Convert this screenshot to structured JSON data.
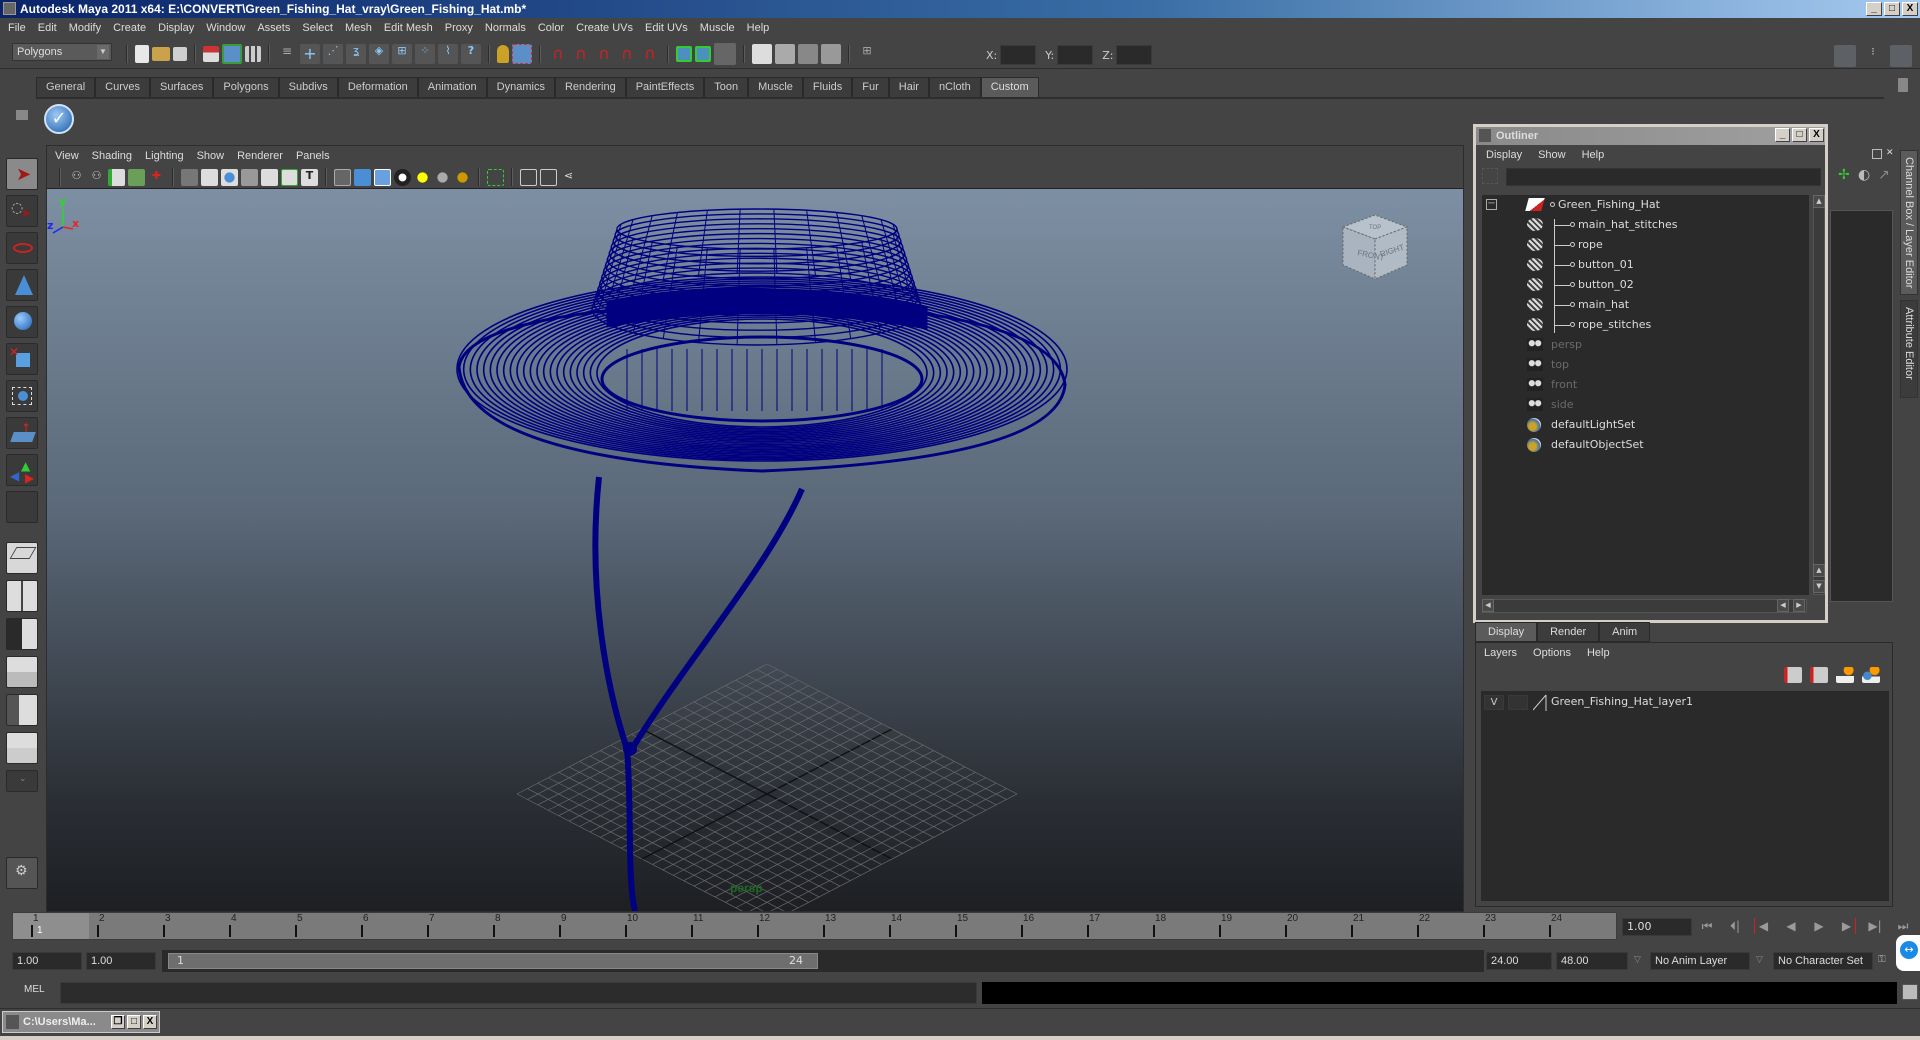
{
  "window": {
    "title": "Autodesk Maya 2011 x64: E:\\CONVERT\\Green_Fishing_Hat_vray\\Green_Fishing_Hat.mb*",
    "controls": [
      "_",
      "□",
      "X"
    ]
  },
  "menubar": [
    "File",
    "Edit",
    "Modify",
    "Create",
    "Display",
    "Window",
    "Assets",
    "Select",
    "Mesh",
    "Edit Mesh",
    "Proxy",
    "Normals",
    "Color",
    "Create UVs",
    "Edit UVs",
    "Muscle",
    "Help"
  ],
  "statusline": {
    "mode": "Polygons",
    "icons": [
      "new-scene-icon",
      "open-scene-icon",
      "save-scene-icon",
      "select-by-hierarchy-icon",
      "select-by-object-icon",
      "select-by-component-icon",
      "lock-selection-icon",
      "snap-grid-icon",
      "snap-curve-icon",
      "snap-point-icon",
      "snap-view-plane-icon",
      "make-live-icon",
      "history-icon",
      "render-icon",
      "ipr-render-icon",
      "render-settings-icon"
    ],
    "x_label": "X:",
    "y_label": "Y:",
    "z_label": "Z:",
    "x_value": "",
    "y_value": "",
    "z_value": ""
  },
  "shelf": {
    "tabs": [
      "General",
      "Curves",
      "Surfaces",
      "Polygons",
      "Subdivs",
      "Deformation",
      "Animation",
      "Dynamics",
      "Rendering",
      "PaintEffects",
      "Toon",
      "Muscle",
      "Fluids",
      "Fur",
      "Hair",
      "nCloth",
      "Custom"
    ],
    "active_tab": "Custom",
    "items": [
      "checkmark-shelf-icon"
    ]
  },
  "toolbox": {
    "tools": [
      "select-tool",
      "lasso-tool",
      "paint-select-tool",
      "move-tool",
      "rotate-tool",
      "scale-tool",
      "universal-manipulator",
      "soft-modification-tool",
      "show-manipulator-tool",
      "last-tool-used"
    ],
    "layouts": [
      "single-perspective-view",
      "four-view",
      "outliner-persp",
      "graph-editor-persp",
      "hypershade-persp",
      "persp-graph-hypergraph"
    ]
  },
  "viewport": {
    "menu": [
      "View",
      "Shading",
      "Lighting",
      "Show",
      "Renderer",
      "Panels"
    ],
    "camera_label": "persp",
    "viewcube": {
      "front": "FRONT",
      "right": "RIGHT",
      "top": "TOP"
    },
    "axis": {
      "x": "x",
      "y": "y",
      "z": "z"
    },
    "wireframe_color": "#000080"
  },
  "outliner": {
    "title": "Outliner",
    "menu": [
      "Display",
      "Show",
      "Help"
    ],
    "filter_value": "",
    "items": [
      {
        "label": "Green_Fishing_Hat",
        "type": "group",
        "level": 0,
        "dim": false,
        "expanded": true
      },
      {
        "label": "main_hat_stitches",
        "type": "mesh",
        "level": 1,
        "dim": false
      },
      {
        "label": "rope",
        "type": "mesh",
        "level": 1,
        "dim": false
      },
      {
        "label": "button_01",
        "type": "mesh",
        "level": 1,
        "dim": false
      },
      {
        "label": "button_02",
        "type": "mesh",
        "level": 1,
        "dim": false
      },
      {
        "label": "main_hat",
        "type": "mesh",
        "level": 1,
        "dim": false
      },
      {
        "label": "rope_stitches",
        "type": "mesh",
        "level": 1,
        "dim": false
      },
      {
        "label": "persp",
        "type": "camera",
        "level": 0,
        "dim": true
      },
      {
        "label": "top",
        "type": "camera",
        "level": 0,
        "dim": true
      },
      {
        "label": "front",
        "type": "camera",
        "level": 0,
        "dim": true
      },
      {
        "label": "side",
        "type": "camera",
        "level": 0,
        "dim": true
      },
      {
        "label": "defaultLightSet",
        "type": "set",
        "level": 0,
        "dim": false
      },
      {
        "label": "defaultObjectSet",
        "type": "set",
        "level": 0,
        "dim": false
      }
    ]
  },
  "side_tabs": {
    "channel_box": "Channel Box / Layer Editor",
    "attribute_editor": "Attribute Editor"
  },
  "layer_editor": {
    "tabs": [
      "Display",
      "Render",
      "Anim"
    ],
    "active_tab": "Display",
    "menu": [
      "Layers",
      "Options",
      "Help"
    ],
    "layers": [
      {
        "visible": "V",
        "name": "Green_Fishing_Hat_layer1"
      }
    ]
  },
  "timeline": {
    "ticks": [
      "1",
      "2",
      "3",
      "4",
      "5",
      "6",
      "7",
      "8",
      "9",
      "10",
      "11",
      "12",
      "13",
      "14",
      "15",
      "16",
      "17",
      "18",
      "19",
      "20",
      "21",
      "22",
      "23",
      "24"
    ],
    "current_frame_marker": "1",
    "current_time": "1.00",
    "playback_buttons": [
      "go-to-start",
      "step-back-key",
      "step-back-frame",
      "play-backward",
      "play-forward",
      "step-forward-frame",
      "step-forward-key",
      "go-to-end"
    ]
  },
  "range": {
    "start_time": "1.00",
    "playback_start": "1.00",
    "range_start_label": "1",
    "range_end_label": "24",
    "playback_end": "24.00",
    "end_time": "48.00",
    "anim_layer": "No Anim Layer",
    "character_set": "No Character Set"
  },
  "command_line": {
    "label": "MEL",
    "input": "",
    "output": ""
  },
  "minimized_window": {
    "title": "C:\\Users\\Ma..."
  }
}
